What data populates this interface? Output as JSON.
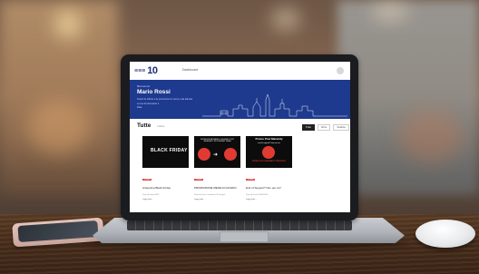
{
  "site": {
    "logo_mark": "≡≡≡",
    "logo_number": "10",
    "nav_label": "Dashboard"
  },
  "hero": {
    "welcome": "Benvenuto",
    "name": "Mario Rossi",
    "subtitle": "Scopri le offerte e le promozioni in corso e da attivare",
    "line2": "Le tue Anniversario 1",
    "line3": "Data"
  },
  "section": {
    "title": "Tutte",
    "filter": "4 attive",
    "sort_options": [
      "Tutte",
      "Attive",
      "Scadute"
    ]
  },
  "cards": [
    {
      "tag": "Promo",
      "image_text": "BLACK FRIDAY",
      "title": "Anteprima Black Friday",
      "meta": "Data di Inizio 01/11",
      "link": "Leggi tutto →"
    },
    {
      "tag": "Promo",
      "image_text": "PROMOZIONE MESE DI GIUGNO POST INDEMNITY IN INTERNET SPAM",
      "title": "PROMOZIONE MESE DI GIUGNO",
      "meta": "Data di inizio / scadenza 30 Giugno",
      "link": "Leggi tutto →"
    },
    {
      "tag": "Promo",
      "image_text_top": "Promo Post Maranity",
      "image_text_sub": "end of support? fare per voi",
      "image_text_bottom": "PROMO POST INDEMNITY PROPOSTE",
      "title": "End of Support? Non per voi!",
      "meta": "Data di inizio 01/06/2024",
      "link": "Leggi tutto →"
    }
  ],
  "colors": {
    "hero_bg": "#1e3a8e",
    "tag_red": "#e04848",
    "accent_red": "#e03b32"
  }
}
